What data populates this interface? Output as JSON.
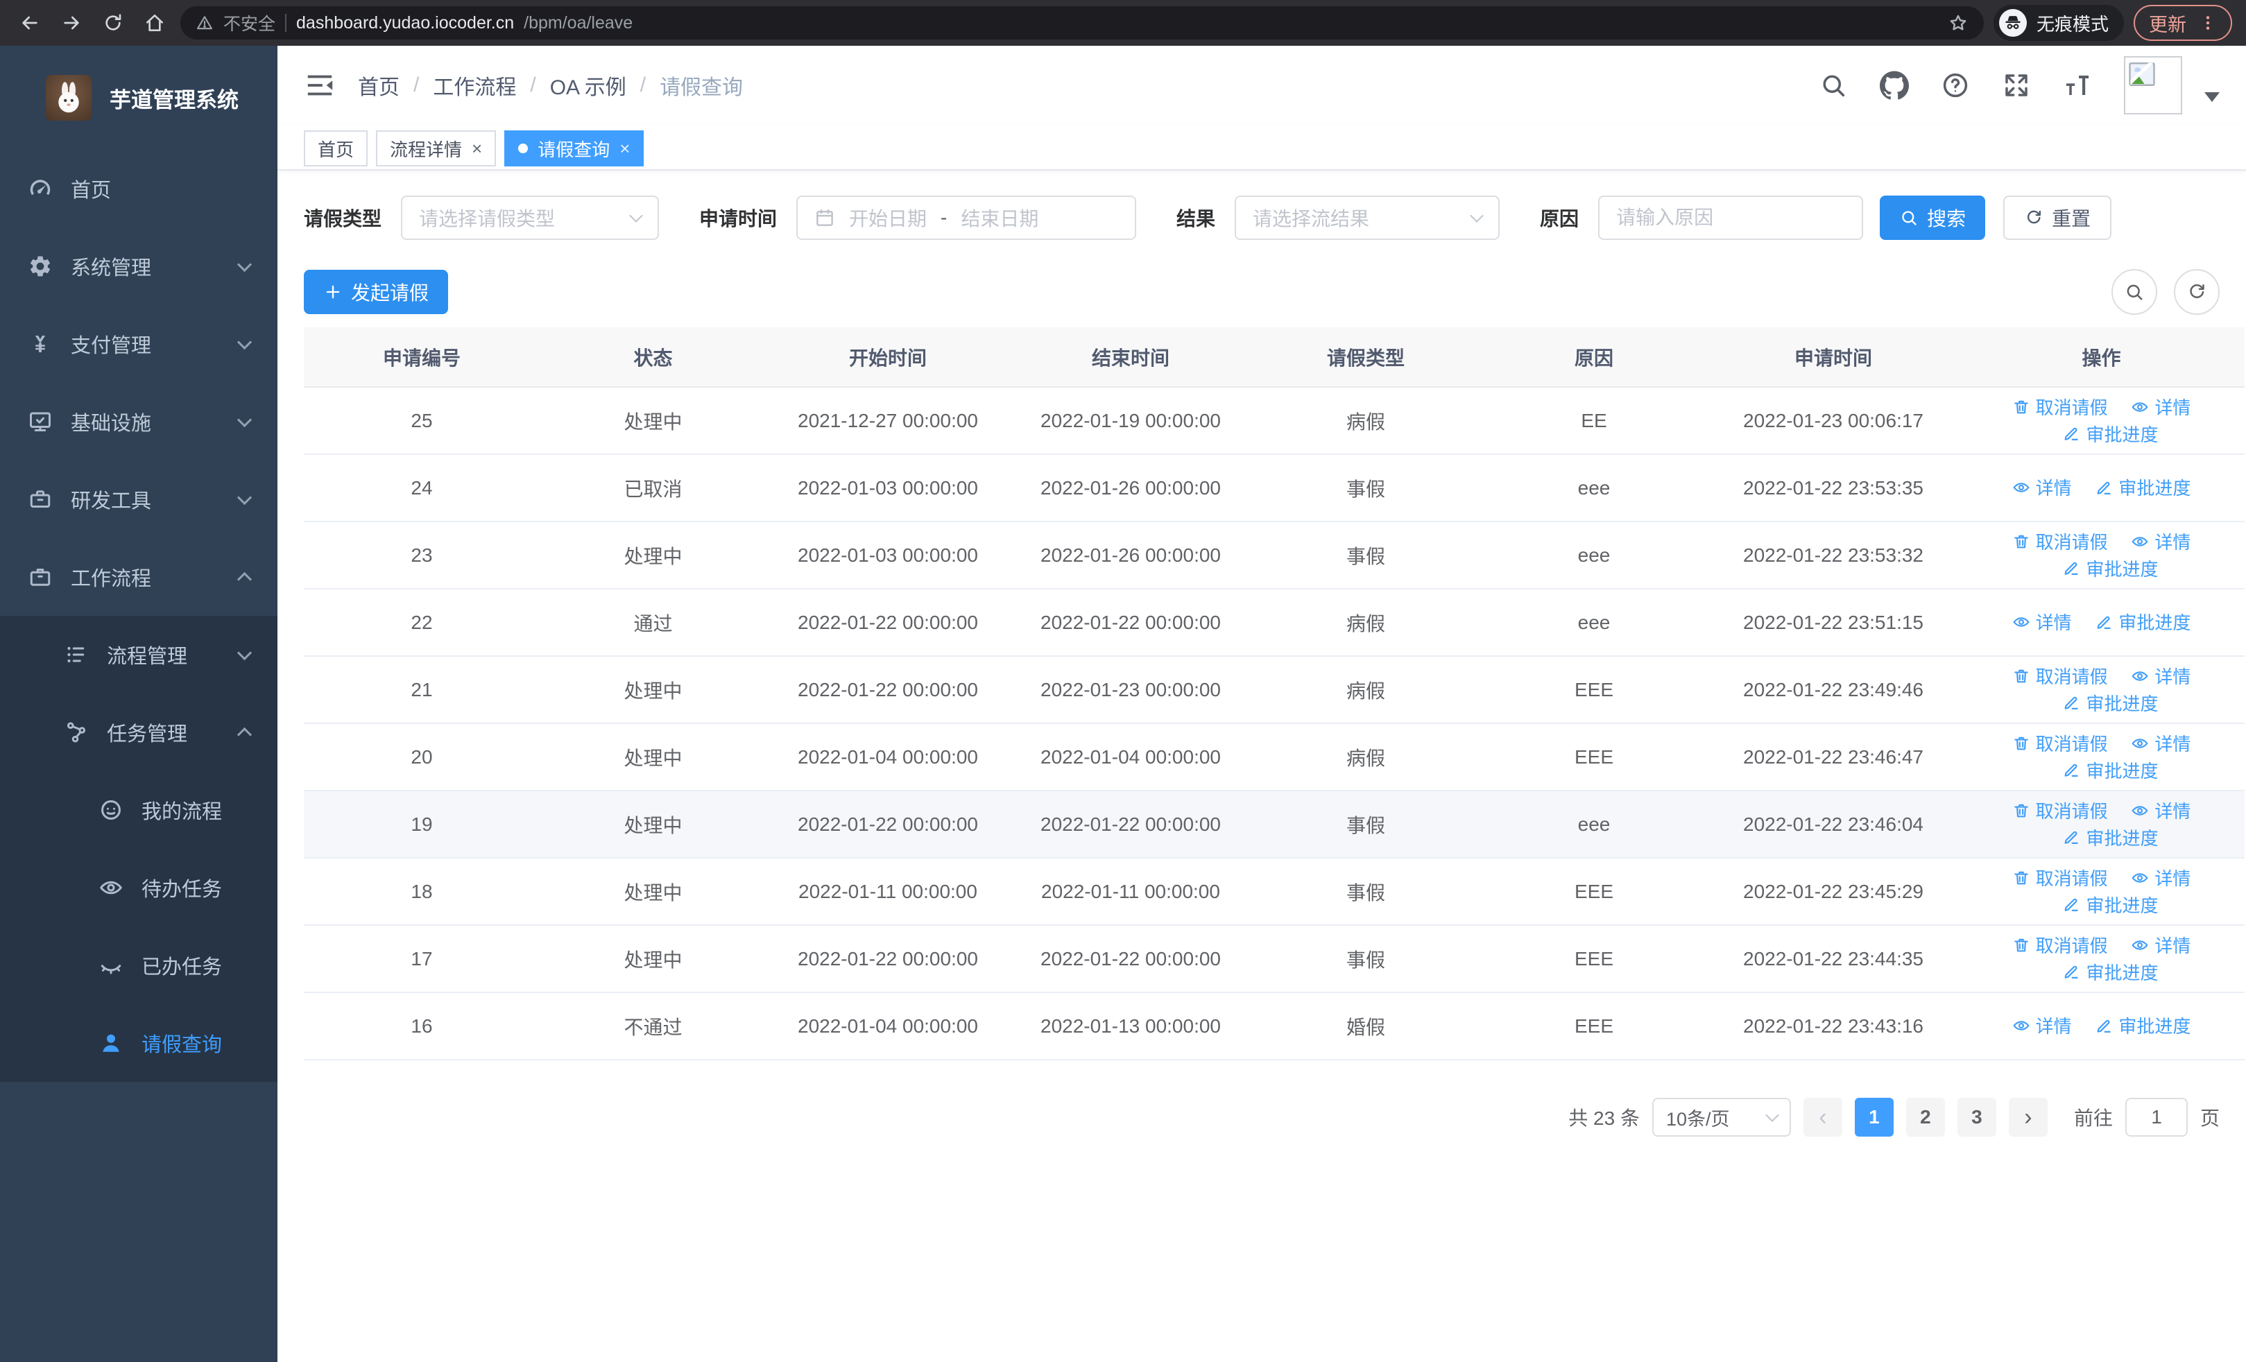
{
  "browser": {
    "security_label": "不安全",
    "url_host": "dashboard.yudao.iocoder.cn",
    "url_path": "/bpm/oa/leave",
    "incognito_label": "无痕模式",
    "update_label": "更新",
    "nav_icons": [
      {
        "icon": "back-icon"
      },
      {
        "icon": "forward-icon"
      },
      {
        "icon": "reload-icon"
      },
      {
        "icon": "home-icon"
      }
    ]
  },
  "colors": {
    "accent_blue": "#409eff",
    "sidebar_bg": "#304156",
    "sidebar_submenu_bg": "#263445",
    "update_salmon": "#f0a49c",
    "table_header_bg": "#f8f8f9"
  },
  "sidebar": {
    "title": "芋道管理系统",
    "logo_icon": "rabbit-logo-icon",
    "items": [
      {
        "icon": "dashboard-icon",
        "label": "首页",
        "level": 1
      },
      {
        "icon": "gear-icon",
        "label": "系统管理",
        "level": 1,
        "chev_down": true
      },
      {
        "icon": "yen-icon",
        "label": "支付管理",
        "level": 1,
        "chev_down": true
      },
      {
        "icon": "monitor-icon",
        "label": "基础设施",
        "level": 1,
        "chev_down": true
      },
      {
        "icon": "toolbox-icon",
        "label": "研发工具",
        "level": 1,
        "chev_down": true
      },
      {
        "icon": "briefcase-icon",
        "label": "工作流程",
        "level": 1,
        "chev_up": true
      },
      {
        "icon": "tree-table-icon",
        "label": "流程管理",
        "level": 2,
        "chev_down": true,
        "submenu": true
      },
      {
        "icon": "share-icon",
        "label": "任务管理",
        "level": 2,
        "chev_up": true,
        "submenu": true
      },
      {
        "icon": "face-icon",
        "label": "我的流程",
        "level": 3,
        "submenu": true
      },
      {
        "icon": "eye-open-icon",
        "label": "待办任务",
        "level": 3,
        "submenu": true
      },
      {
        "icon": "eye-closed-icon",
        "label": "已办任务",
        "level": 3,
        "submenu": true
      },
      {
        "icon": "user-icon",
        "label": "请假查询",
        "level": 3,
        "submenu": true,
        "active": true
      }
    ]
  },
  "header": {
    "breadcrumb": [
      {
        "label": "首页",
        "sep": true
      },
      {
        "label": "工作流程",
        "sep": true
      },
      {
        "label": "OA 示例",
        "sep": true
      },
      {
        "label": "请假查询",
        "last": true
      }
    ],
    "action_icons": [
      {
        "icon": "search-icon"
      },
      {
        "icon": "github-icon"
      },
      {
        "icon": "help-icon"
      },
      {
        "icon": "fullscreen-icon"
      },
      {
        "icon": "font-size-icon"
      }
    ]
  },
  "tabs": [
    {
      "label": "首页"
    },
    {
      "label": "流程详情",
      "closable": true
    },
    {
      "label": "请假查询",
      "closable": true,
      "active": true,
      "dot": true
    }
  ],
  "filters": {
    "leave_type_label": "请假类型",
    "leave_type_placeholder": "请选择请假类型",
    "apply_time_label": "申请时间",
    "start_date_placeholder": "开始日期",
    "range_separator": "-",
    "end_date_placeholder": "结束日期",
    "result_label": "结果",
    "result_placeholder": "请选择流结果",
    "reason_label": "原因",
    "reason_placeholder": "请输入原因",
    "search_label": "搜索",
    "reset_label": "重置"
  },
  "toolbar": {
    "create_label": "发起请假"
  },
  "table": {
    "headers": [
      "申请编号",
      "状态",
      "开始时间",
      "结束时间",
      "请假类型",
      "原因",
      "申请时间",
      "操作"
    ],
    "action_cancel": "取消请假",
    "action_detail": "详情",
    "action_progress": "审批进度",
    "rows": [
      {
        "id": "25",
        "status": "处理中",
        "start": "2021-12-27 00:00:00",
        "end": "2022-01-19 00:00:00",
        "type": "病假",
        "reason": "EE",
        "applied": "2022-01-23 00:06:17",
        "can_cancel": true
      },
      {
        "id": "24",
        "status": "已取消",
        "start": "2022-01-03 00:00:00",
        "end": "2022-01-26 00:00:00",
        "type": "事假",
        "reason": "eee",
        "applied": "2022-01-22 23:53:35"
      },
      {
        "id": "23",
        "status": "处理中",
        "start": "2022-01-03 00:00:00",
        "end": "2022-01-26 00:00:00",
        "type": "事假",
        "reason": "eee",
        "applied": "2022-01-22 23:53:32",
        "can_cancel": true
      },
      {
        "id": "22",
        "status": "通过",
        "start": "2022-01-22 00:00:00",
        "end": "2022-01-22 00:00:00",
        "type": "病假",
        "reason": "eee",
        "applied": "2022-01-22 23:51:15"
      },
      {
        "id": "21",
        "status": "处理中",
        "start": "2022-01-22 00:00:00",
        "end": "2022-01-23 00:00:00",
        "type": "病假",
        "reason": "EEE",
        "applied": "2022-01-22 23:49:46",
        "can_cancel": true
      },
      {
        "id": "20",
        "status": "处理中",
        "start": "2022-01-04 00:00:00",
        "end": "2022-01-04 00:00:00",
        "type": "病假",
        "reason": "EEE",
        "applied": "2022-01-22 23:46:47",
        "can_cancel": true
      },
      {
        "id": "19",
        "status": "处理中",
        "start": "2022-01-22 00:00:00",
        "end": "2022-01-22 00:00:00",
        "type": "事假",
        "reason": "eee",
        "applied": "2022-01-22 23:46:04",
        "can_cancel": true,
        "highlight": true
      },
      {
        "id": "18",
        "status": "处理中",
        "start": "2022-01-11 00:00:00",
        "end": "2022-01-11 00:00:00",
        "type": "事假",
        "reason": "EEE",
        "applied": "2022-01-22 23:45:29",
        "can_cancel": true
      },
      {
        "id": "17",
        "status": "处理中",
        "start": "2022-01-22 00:00:00",
        "end": "2022-01-22 00:00:00",
        "type": "事假",
        "reason": "EEE",
        "applied": "2022-01-22 23:44:35",
        "can_cancel": true
      },
      {
        "id": "16",
        "status": "不通过",
        "start": "2022-01-04 00:00:00",
        "end": "2022-01-13 00:00:00",
        "type": "婚假",
        "reason": "EEE",
        "applied": "2022-01-22 23:43:16"
      }
    ]
  },
  "pagination": {
    "total_label": "共 23 条",
    "page_size_value": "10条/页",
    "prev_icon": "‹",
    "next_icon": "›",
    "pages": [
      {
        "num": "1",
        "active": true
      },
      {
        "num": "2"
      },
      {
        "num": "3"
      }
    ],
    "goto_label": "前往",
    "goto_value": "1",
    "page_suffix_label": "页"
  }
}
